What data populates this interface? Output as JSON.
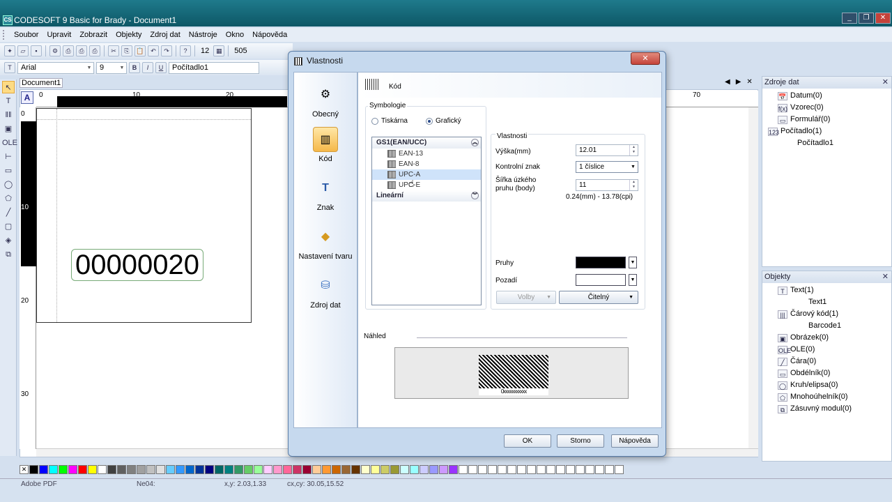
{
  "window": {
    "title": "CODESOFT 9 Basic for Brady - Document1",
    "app_icon": "CS"
  },
  "menu": [
    "Soubor",
    "Upravit",
    "Zobrazit",
    "Objekty",
    "Zdroj dat",
    "Nástroje",
    "Okno",
    "Nápověda"
  ],
  "toolbar": {
    "zoom_small": "12",
    "zoom_value": "505"
  },
  "format_bar": {
    "font": "Arial",
    "size": "9",
    "bold": "B",
    "italic": "I",
    "underline": "U",
    "variable": "Počítadlo1"
  },
  "document": {
    "tab": "Document1",
    "corner_button": "A",
    "ruler_h_labels": [
      "0",
      "10",
      "20",
      "70"
    ],
    "ruler_v_labels": [
      "0",
      "10",
      "20",
      "30"
    ],
    "counter_text": "00000020"
  },
  "data_sources_panel": {
    "title": "Zdroje dat",
    "items": [
      {
        "label": "Datum(0)",
        "icon": "calendar-icon",
        "glyph": "📅"
      },
      {
        "label": "Vzorec(0)",
        "icon": "formula-icon",
        "glyph": "f(x)"
      },
      {
        "label": "Formulář(0)",
        "icon": "form-icon",
        "glyph": "▭"
      },
      {
        "label": "Počítadlo(1)",
        "icon": "counter-icon",
        "glyph": "123"
      },
      {
        "label": "Počítadlo1",
        "icon": "",
        "glyph": ""
      }
    ]
  },
  "objects_panel": {
    "title": "Objekty",
    "items": [
      {
        "label": "Text(1)",
        "icon": "text-icon",
        "glyph": "T",
        "indent": 0
      },
      {
        "label": "Text1",
        "icon": "",
        "glyph": "",
        "indent": 1
      },
      {
        "label": "Čárový kód(1)",
        "icon": "barcode-icon",
        "glyph": "|||",
        "indent": 0
      },
      {
        "label": "Barcode1",
        "icon": "",
        "glyph": "",
        "indent": 1
      },
      {
        "label": "Obrázek(0)",
        "icon": "image-icon",
        "glyph": "▣",
        "indent": 0
      },
      {
        "label": "OLE(0)",
        "icon": "ole-icon",
        "glyph": "OLE",
        "indent": 0
      },
      {
        "label": "Čára(0)",
        "icon": "line-icon",
        "glyph": "╱",
        "indent": 0
      },
      {
        "label": "Obdélník(0)",
        "icon": "rectangle-icon",
        "glyph": "▭",
        "indent": 0
      },
      {
        "label": "Kruh/elipsa(0)",
        "icon": "ellipse-icon",
        "glyph": "◯",
        "indent": 0
      },
      {
        "label": "Mnohoúhelník(0)",
        "icon": "polygon-icon",
        "glyph": "⬠",
        "indent": 0
      },
      {
        "label": "Zásuvný modul(0)",
        "icon": "plugin-icon",
        "glyph": "⧉",
        "indent": 0
      }
    ]
  },
  "statusbar": {
    "printer": "Adobe PDF",
    "port": "Ne04:",
    "xy": "x,y: 2.03,1.33",
    "cxcy": "cx,cy: 30.05,15.52"
  },
  "palette": [
    "#000000",
    "#0000ff",
    "#00ffff",
    "#00ff00",
    "#ff00ff",
    "#ff0000",
    "#ffff00",
    "#ffffff",
    "#404040",
    "#606060",
    "#808080",
    "#a0a0a0",
    "#c0c0c0",
    "#e0e0e0",
    "#66ccff",
    "#3399ff",
    "#0066cc",
    "#003399",
    "#000080",
    "#006666",
    "#008080",
    "#339966",
    "#66cc66",
    "#99ff99",
    "#ffccff",
    "#ff99cc",
    "#ff6699",
    "#cc3366",
    "#990033",
    "#ffcc99",
    "#ff9933",
    "#cc6600",
    "#996633",
    "#663300",
    "#ffffcc",
    "#ffff99",
    "#cccc66",
    "#999933",
    "#ccffff",
    "#99ffff",
    "#ccccff",
    "#9999ff",
    "#cc99ff",
    "#9933ff",
    "#ffffff",
    "#ffffff",
    "#ffffff",
    "#ffffff",
    "#ffffff",
    "#ffffff",
    "#ffffff",
    "#ffffff",
    "#ffffff",
    "#ffffff",
    "#ffffff",
    "#ffffff",
    "#ffffff",
    "#ffffff",
    "#ffffff",
    "#ffffff",
    "#ffffff"
  ],
  "dialog": {
    "title": "Vlastnosti",
    "close": "✕",
    "sidebar": [
      {
        "label": "Obecný",
        "icon": "general-gear-icon",
        "glyph": "⚙"
      },
      {
        "label": "Kód",
        "icon": "barcode-icon",
        "glyph": "▥",
        "selected": true
      },
      {
        "label": "Znak",
        "icon": "text-char-icon",
        "glyph": "T"
      },
      {
        "label": "Nastavení tvaru",
        "icon": "shape-icon",
        "glyph": "◆"
      },
      {
        "label": "Zdroj dat",
        "icon": "database-icon",
        "glyph": "⛁"
      }
    ],
    "header": "Kód",
    "symbology": {
      "label": "Symbologie",
      "radio_printer": "Tiskárna",
      "radio_graphic": "Grafický",
      "selected": "graphic",
      "categories": [
        {
          "name": "GS1(EAN/UCC)",
          "chev": "︽",
          "items": [
            "EAN-13",
            "EAN-8",
            "UPC-A",
            "UPC-E"
          ]
        },
        {
          "name": "Lineární",
          "chev": "︾",
          "items": []
        }
      ],
      "selected_item": "UPC-A"
    },
    "properties": {
      "label": "Vlastnosti",
      "height_label": "Výška(mm)",
      "height_value": "12.01",
      "check_label": "Kontrolní znak",
      "check_value": "1 číslice",
      "narrow_label": "Šířka úzkého pruhu (body)",
      "narrow_value": "11",
      "range": "0.24(mm) - 13.78(cpi)",
      "bars_label": "Pruhy",
      "bars_color": "#000000",
      "background_label": "Pozadí",
      "background_color": "#ffffff",
      "options_button": "Volby",
      "readable_button": "Čitelný"
    },
    "preview_label": "Náhled",
    "preview_digits": "0xxxxxxxxxxx",
    "buttons": {
      "ok": "OK",
      "cancel": "Storno",
      "help": "Nápověda"
    }
  }
}
